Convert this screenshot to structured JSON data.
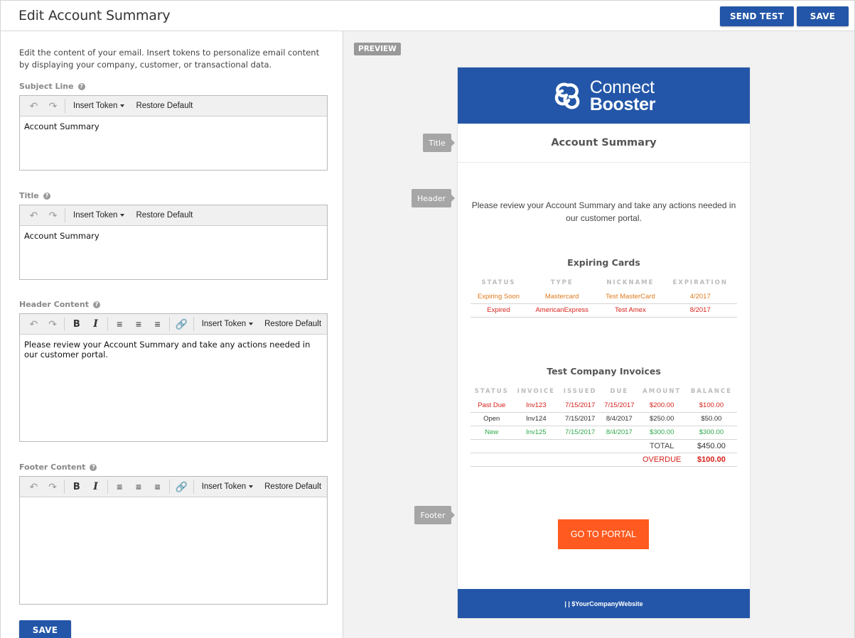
{
  "header": {
    "title": "Edit Account Summary",
    "send_test_label": "SEND TEST",
    "save_label": "SAVE"
  },
  "left": {
    "intro": "Edit the content of your email. Insert tokens to personalize email content by displaying your company, customer, or transactional data.",
    "toolbar": {
      "insert_token": "Insert Token",
      "restore_default": "Restore Default",
      "bold": "B",
      "italic": "I"
    },
    "subject": {
      "label": "Subject Line",
      "value": "Account Summary"
    },
    "title": {
      "label": "Title",
      "value": "Account Summary"
    },
    "header_content": {
      "label": "Header Content",
      "value": "Please review your Account Summary and take any actions needed in our customer portal."
    },
    "footer_content": {
      "label": "Footer Content",
      "value": ""
    },
    "save_label": "SAVE"
  },
  "preview": {
    "badge": "PREVIEW",
    "logo_line1": "Connect",
    "logo_line2": "Booster",
    "title": "Account Summary",
    "header_text": "Please review your Account Summary and take any actions needed in our customer portal.",
    "tags": {
      "title": "Title",
      "header": "Header",
      "footer": "Footer"
    },
    "expiring_cards": {
      "title": "Expiring Cards",
      "columns": [
        "STATUS",
        "TYPE",
        "NICKNAME",
        "EXPIRATION"
      ],
      "rows": [
        {
          "status": "Expiring Soon",
          "type": "Mastercard",
          "nickname": "Test MasterCard",
          "expiration": "4/2017"
        },
        {
          "status": "Expired",
          "type": "AmericanExpress",
          "nickname": "Test Amex",
          "expiration": "8/2017"
        }
      ]
    },
    "invoices": {
      "title": "Test Company Invoices",
      "columns": [
        "STATUS",
        "INVOICE",
        "ISSUED",
        "DUE",
        "AMOUNT",
        "BALANCE"
      ],
      "rows": [
        {
          "status": "Past Due",
          "invoice": "Inv123",
          "issued": "7/15/2017",
          "due": "7/15/2017",
          "amount": "$200.00",
          "balance": "$100.00"
        },
        {
          "status": "Open",
          "invoice": "Inv124",
          "issued": "7/15/2017",
          "due": "8/4/2017",
          "amount": "$250.00",
          "balance": "$50.00"
        },
        {
          "status": "New",
          "invoice": "Inv125",
          "issued": "7/15/2017",
          "due": "8/4/2017",
          "amount": "$300.00",
          "balance": "$300.00"
        }
      ],
      "total_label": "TOTAL",
      "total_value": "$450.00",
      "overdue_label": "OVERDUE",
      "overdue_value": "$100.00"
    },
    "portal_button": "GO TO PORTAL",
    "footer_text": "| | $YourCompanyWebsite"
  },
  "colors": {
    "brand_blue": "#2356a8",
    "portal_orange": "#ff5a1f",
    "status_orange": "#e07a1c",
    "status_red": "#d8221b",
    "status_green": "#2ea84a"
  }
}
